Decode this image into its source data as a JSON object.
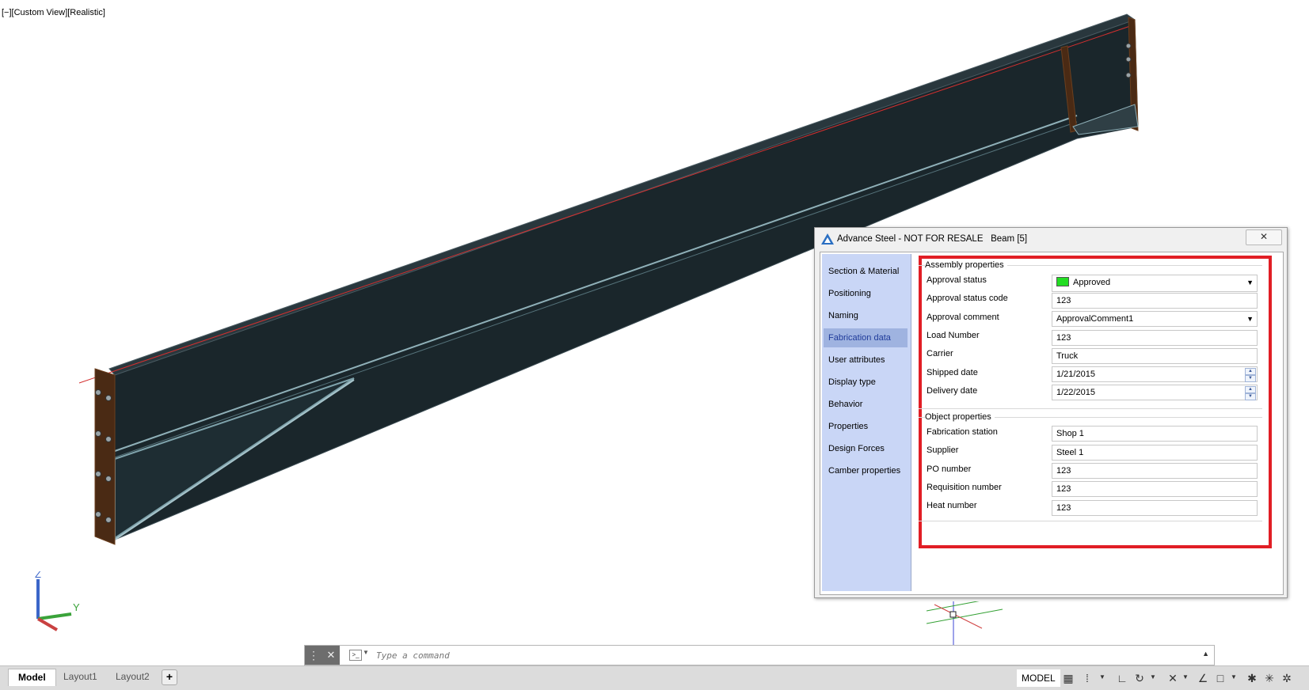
{
  "viewport": {
    "view_label": "[−][Custom View][Realistic]"
  },
  "ucs": {
    "z_label": "Z",
    "y_label": "Y"
  },
  "dialog": {
    "title": "Advance Steel - NOT FOR RESALE   Beam [5]",
    "close_glyph": "✕",
    "nav": {
      "items": [
        {
          "label": "Section & Material"
        },
        {
          "label": "Positioning"
        },
        {
          "label": "Naming"
        },
        {
          "label": "Fabrication data"
        },
        {
          "label": "User attributes"
        },
        {
          "label": "Display type"
        },
        {
          "label": "Behavior"
        },
        {
          "label": "Properties"
        },
        {
          "label": "Design Forces"
        },
        {
          "label": "Camber properties"
        }
      ],
      "active": "Fabrication data"
    },
    "assembly": {
      "title": "Assembly properties",
      "approval_status_label": "Approval status",
      "approval_status_value": "Approved",
      "approval_status_color": "#22dd22",
      "approval_status_code_label": "Approval status code",
      "approval_status_code_value": "123",
      "approval_comment_label": "Approval comment",
      "approval_comment_value": "ApprovalComment1",
      "load_number_label": "Load Number",
      "load_number_value": "123",
      "carrier_label": "Carrier",
      "carrier_value": "Truck",
      "shipped_date_label": "Shipped date",
      "shipped_date_value": "1/21/2015",
      "delivery_date_label": "Delivery date",
      "delivery_date_value": "1/22/2015"
    },
    "object": {
      "title": "Object properties",
      "fabrication_station_label": "Fabrication station",
      "fabrication_station_value": "Shop 1",
      "supplier_label": "Supplier",
      "supplier_value": "Steel 1",
      "po_number_label": "PO number",
      "po_number_value": "123",
      "requisition_number_label": "Requisition number",
      "requisition_number_value": "123",
      "heat_number_label": "Heat number",
      "heat_number_value": "123"
    },
    "highlight_color": "#e11e25"
  },
  "command_line": {
    "placeholder": "Type a command"
  },
  "status_bar": {
    "tabs": [
      "Model",
      "Layout1",
      "Layout2"
    ],
    "active_tab": "Model",
    "add_tab_glyph": "+",
    "space_label": "MODEL"
  }
}
